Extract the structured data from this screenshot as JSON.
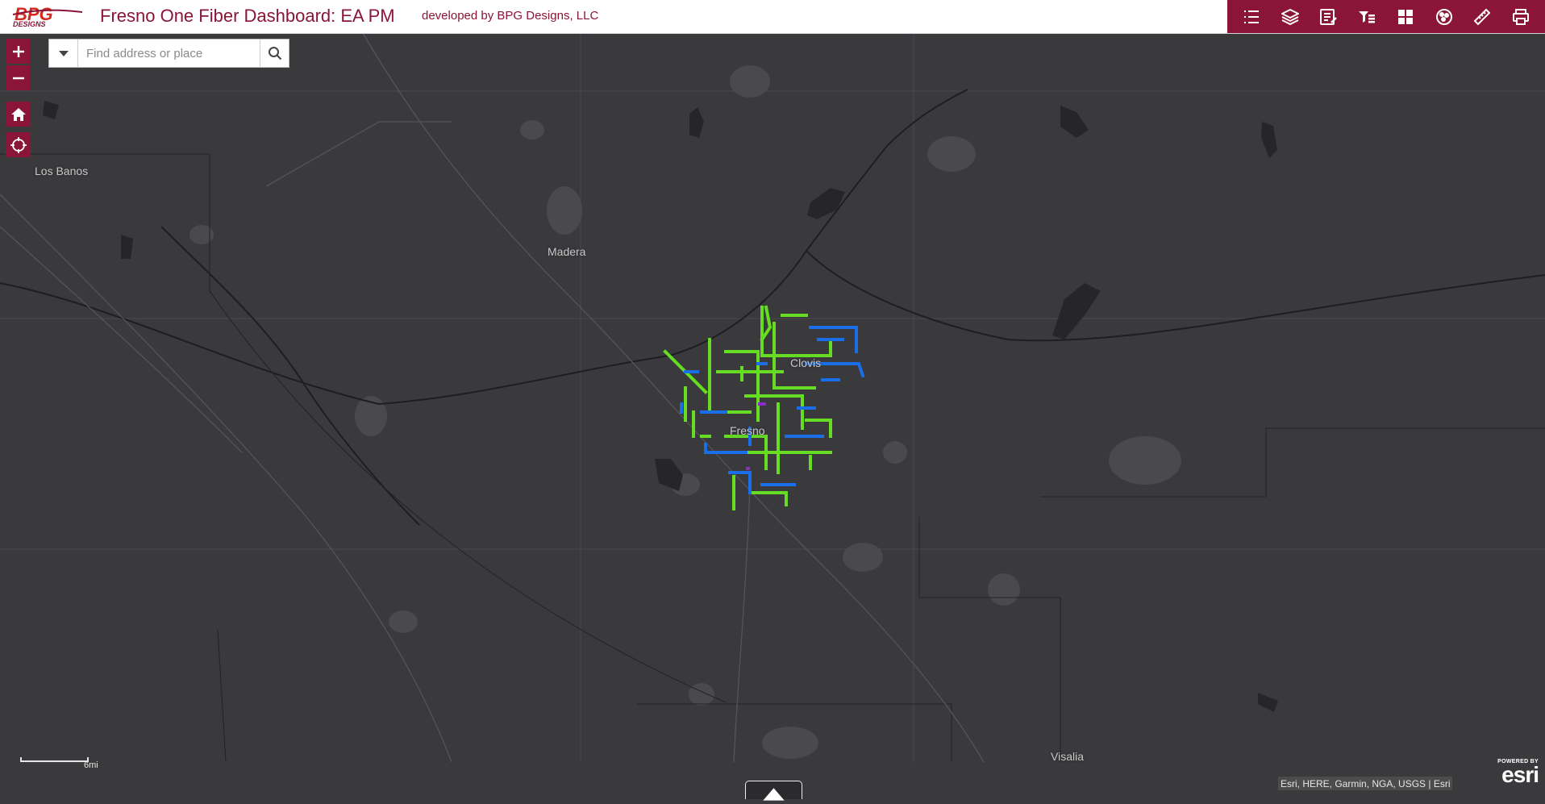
{
  "header": {
    "logo_alt": "BPG Designs",
    "title": "Fresno One Fiber Dashboard: EA PM",
    "subtitle": "developed by BPG Designs, LLC",
    "tools": [
      {
        "name": "legend-icon"
      },
      {
        "name": "layers-icon"
      },
      {
        "name": "layer-list-icon"
      },
      {
        "name": "filter-icon"
      },
      {
        "name": "basemap-gallery-icon"
      },
      {
        "name": "analysis-icon"
      },
      {
        "name": "measure-icon"
      },
      {
        "name": "print-icon"
      }
    ],
    "accent_color": "#8a1538"
  },
  "search": {
    "placeholder": "Find address or place",
    "value": ""
  },
  "map": {
    "labels": {
      "los_banos": "Los Banos",
      "madera": "Madera",
      "clovis": "Clovis",
      "fresno": "Fresno",
      "visalia": "Visalia"
    },
    "fiber_colors": {
      "green": "#66dd22",
      "blue": "#1a6fe8",
      "purple": "#8a2ad0"
    },
    "scale": {
      "label": "6mi"
    },
    "attribution": "Esri, HERE, Garmin, NGA, USGS | Esri",
    "esri": {
      "powered": "POWERED BY",
      "word": "esri"
    }
  }
}
